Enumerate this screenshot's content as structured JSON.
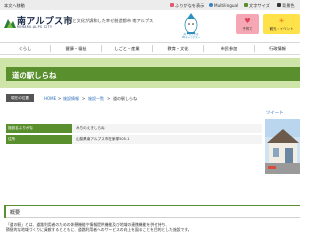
{
  "util": {
    "skip_link": "本文へ移動",
    "items": [
      {
        "label": "ふりがなを表示",
        "icon": "furigana-icon"
      },
      {
        "label": "Multilingual",
        "icon": "globe-icon"
      },
      {
        "label": "文字サイズ",
        "icon": "text-size-icon"
      },
      {
        "label": "背景色",
        "icon": "contrast-icon"
      }
    ]
  },
  "header": {
    "logo_title": "南アルプス市",
    "logo_sub": "MINAMI-ALPS CITY",
    "slogan": "自然と文化が調和した幸せ創造都市 南アルプス",
    "mascot_caption_1": "南アルプス市",
    "mascot_caption_2": "PRキャラクター",
    "kosodate_label": "子育て",
    "kanko_label": "観光・イベント"
  },
  "gnav": {
    "items": [
      "くらし",
      "健康・福祉",
      "しごと・産業",
      "教育・文化",
      "市民参加",
      "行政情報"
    ]
  },
  "page": {
    "title": "道の駅しらね"
  },
  "breadcrumb": {
    "here_label": "現在の位置",
    "items": [
      "HOME",
      "施設情報",
      "施設一覧",
      "道の駅しらね"
    ],
    "separator": ">"
  },
  "side": {
    "tweet": "ツイート"
  },
  "info": {
    "rows": [
      {
        "label": "施設名ふりがな",
        "value": "みちのえきしらね"
      },
      {
        "label": "住所",
        "value": "山梨県南アルプス市在家塚505-1"
      }
    ]
  },
  "overview": {
    "heading": "概要",
    "lines": [
      "「道の駅」とは、道路利用者のための休憩機能や情報提供機能及び地域の連携機能を併せ持ち、",
      "積極的な地域づくりに貢献するとともに、道路利用者へのサービスの向上を図ることを目的とした施設です。"
    ]
  },
  "colors": {
    "accent_green": "#5a8f2e",
    "band_green": "#cfe4a9",
    "kosodate_pink": "#f6a7b4",
    "kanko_yellow": "#ffe24a"
  }
}
